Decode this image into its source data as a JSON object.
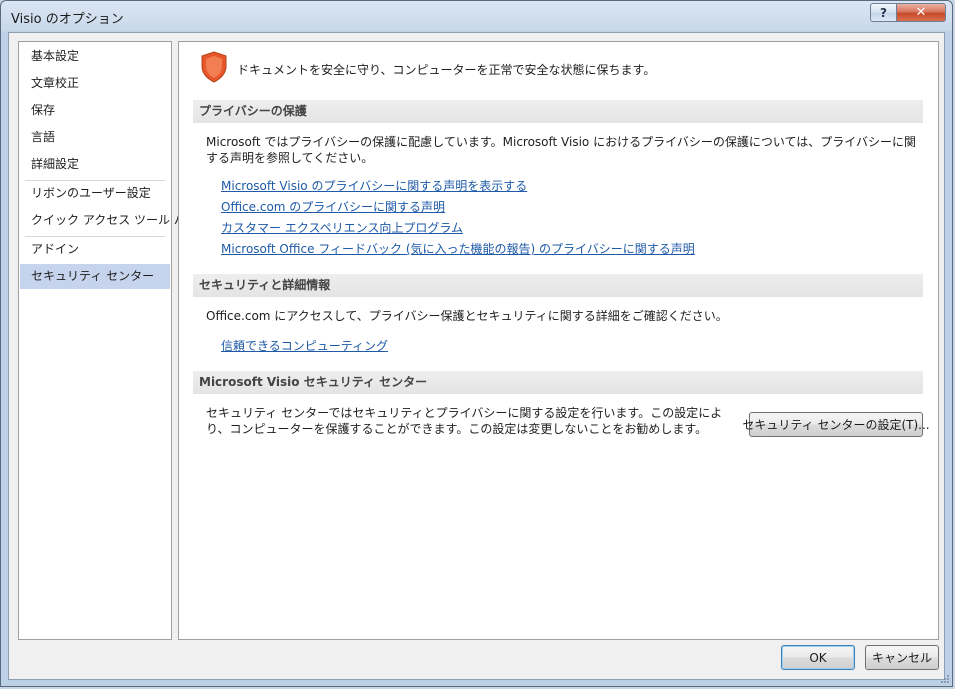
{
  "window": {
    "title": "Visio のオプション",
    "help_label": "?",
    "close_label": "✕"
  },
  "nav": {
    "items": [
      "基本設定",
      "文章校正",
      "保存",
      "言語",
      "詳細設定",
      "リボンのユーザー設定",
      "クイック アクセス ツール バー",
      "アドイン",
      "セキュリティ センター"
    ],
    "selected": "セキュリティ センター"
  },
  "content": {
    "intro": "ドキュメントを安全に守り、コンピューターを正常で安全な状態に保ちます。",
    "privacy": {
      "header": "プライバシーの保護",
      "text": "Microsoft ではプライバシーの保護に配慮しています。Microsoft Visio におけるプライバシーの保護については、プライバシーに関する声明を参照してください。",
      "links": [
        "Microsoft Visio のプライバシーに関する声明を表示する",
        "Office.com のプライバシーに関する声明",
        "カスタマー エクスペリエンス向上プログラム",
        "Microsoft Office フィードバック (気に入った機能の報告) のプライバシーに関する声明"
      ]
    },
    "security": {
      "header": "セキュリティと詳細情報",
      "text": "Office.com にアクセスして、プライバシー保護とセキュリティに関する詳細をご確認ください。",
      "link": "信頼できるコンピューティング"
    },
    "trust_center": {
      "header": "Microsoft Visio セキュリティ センター",
      "text": "セキュリティ センターではセキュリティとプライバシーに関する設定を行います。この設定により、コンピューターを保護することができます。この設定は変更しないことをお勧めします。",
      "button": "セキュリティ センターの設定(T)..."
    }
  },
  "footer": {
    "ok": "OK",
    "cancel": "キャンセル"
  },
  "colors": {
    "selected_nav": "#c5d3ec",
    "link": "#1e5aa8",
    "shield": "#e8572a",
    "close_button": "#c74a2c"
  }
}
